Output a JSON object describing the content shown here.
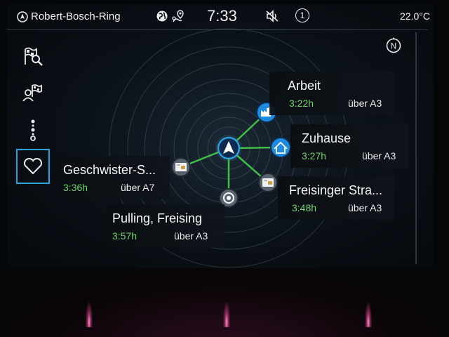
{
  "statusbar": {
    "location": "Robert-Bosch-Ring",
    "time": "7:33",
    "badge": "1",
    "temperature": "22.0°C"
  },
  "sidebar": {
    "items": [
      {
        "name": "search-destination",
        "icon": "flag-search-icon"
      },
      {
        "name": "contacts-destination",
        "icon": "person-flag-icon"
      },
      {
        "name": "route-stops",
        "icon": "route-icon"
      },
      {
        "name": "favorites",
        "icon": "heart-icon",
        "active": true
      }
    ]
  },
  "compass_label": "N",
  "destinations": [
    {
      "name": "Arbeit",
      "time": "3:22h",
      "via": "über A3",
      "icon": "factory-icon"
    },
    {
      "name": "Zuhause",
      "time": "3:27h",
      "via": "über A3",
      "icon": "home-icon"
    },
    {
      "name": "Freisinger Stra...",
      "time": "3:48h",
      "via": "über A3",
      "icon": "contact-card-icon"
    },
    {
      "name": "Pulling, Freising",
      "time": "3:57h",
      "via": "über A3",
      "icon": "poi-dot-icon"
    },
    {
      "name": "Geschwister-S...",
      "time": "3:36h",
      "via": "über A7",
      "icon": "contact-card-icon"
    }
  ],
  "colors": {
    "accent": "#2aa3dc",
    "time_green": "#6fd36a",
    "connector_green": "#3fbf45"
  }
}
